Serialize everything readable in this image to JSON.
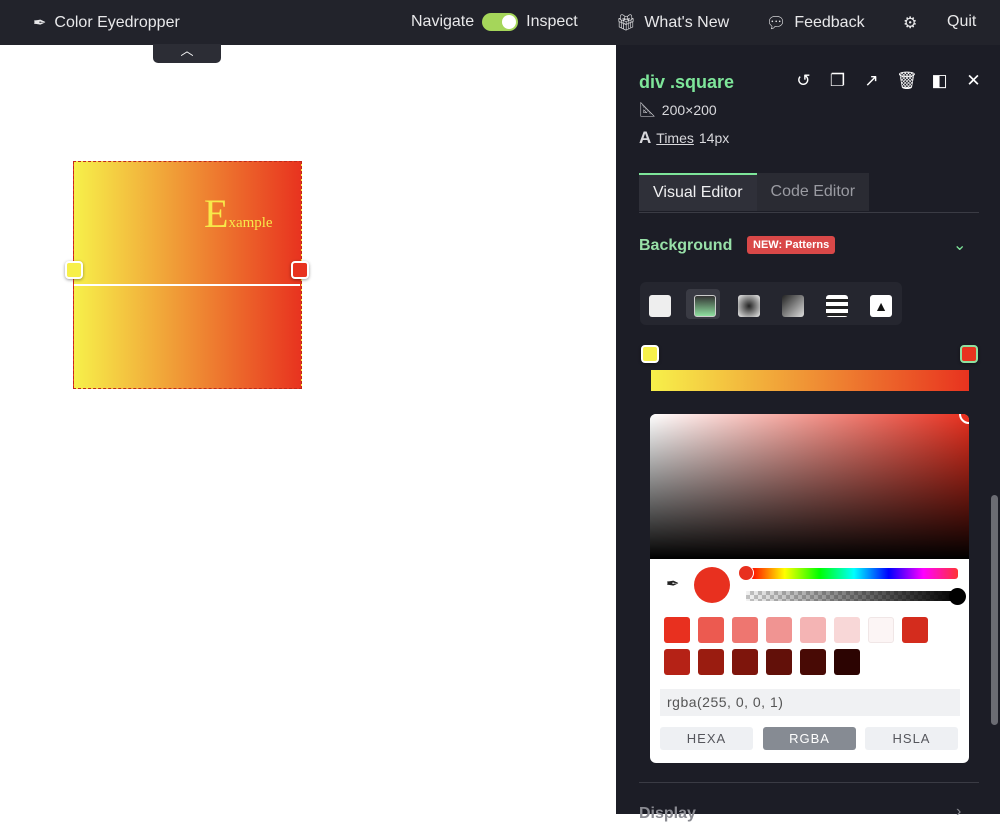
{
  "topbar": {
    "app": "Color Eyedropper",
    "navigate": "Navigate",
    "inspect": "Inspect",
    "whats_new": "What's New",
    "feedback": "Feedback",
    "quit": "Quit"
  },
  "canvas": {
    "example_big": "E",
    "example_small": "xample"
  },
  "panel": {
    "selector": "div .square",
    "size": "200×200",
    "font_name": "Times",
    "font_size": "14px",
    "tabs": [
      "Visual Editor",
      "Code Editor"
    ],
    "section": "Background",
    "badge": "NEW: Patterns",
    "next_section": "Display",
    "picker": {
      "value": "rgba(255, 0, 0, 1)",
      "formats": [
        "HEXA",
        "RGBA",
        "HSLA"
      ],
      "active_format": "RGBA",
      "swatches": [
        "#e8301f",
        "#ec5a50",
        "#ee7670",
        "#f09492",
        "#f4b4b4",
        "#f8d7d7",
        "#fcf5f5",
        "#d42c1d",
        "#b52216",
        "#9a1c10",
        "#7e150c",
        "#621009",
        "#480a05",
        "#2c0402"
      ]
    },
    "gradient_stops": [
      "#f7f04a",
      "#e8331f"
    ]
  }
}
